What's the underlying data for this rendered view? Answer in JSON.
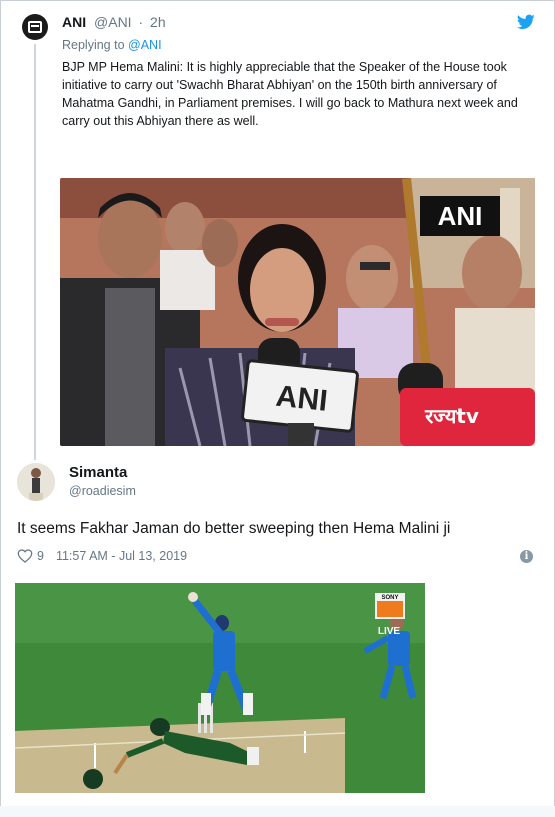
{
  "quoted_tweet": {
    "name": "ANI",
    "handle": "@ANI",
    "separator": "·",
    "time": "2h",
    "replying_to": "Replying to",
    "replying_handle": "@ANI",
    "text": "BJP MP Hema Malini: It is highly appreciable that the Speaker of the House took initiative to carry out 'Swachh Bharat Abhiyan' on the 150th birth anniversary of Mahatma Gandhi, in Parliament premises. I will go back to Mathura next week and carry out this Abhiyan there as well.",
    "photo_watermark": "ANI",
    "mic_label": "ANI",
    "mic2_label": "रज्यtv"
  },
  "tweet": {
    "name": "Simanta",
    "handle": "@roadiesim",
    "text": "It seems Fakhar Jaman do better sweeping then Hema Malini ji",
    "likes": "9",
    "timestamp": "11:57 AM - Jul 13, 2019",
    "broadcaster_logo": "SONY",
    "live_label": "LIVE"
  },
  "icons": {
    "twitter_bird": "twitter-bird-icon",
    "heart": "heart-icon",
    "info": "info-icon",
    "avatar_ani": "ani-logo-avatar"
  },
  "colors": {
    "twitter_blue": "#1da1f2",
    "link_blue": "#1b95e0",
    "secondary_text": "#657786",
    "pitch_green": "#3f8a3b",
    "india_blue": "#1f6fd1",
    "pakistan_green": "#1c5a2a"
  }
}
